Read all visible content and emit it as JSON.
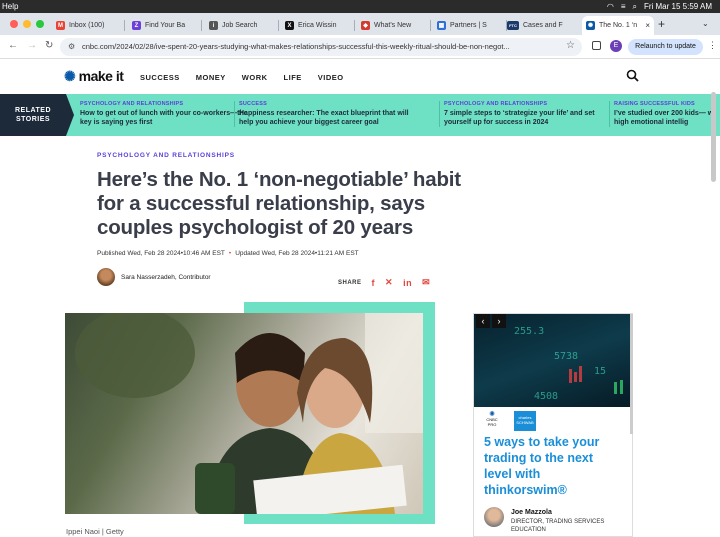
{
  "menubar": {
    "app_menu": "Help",
    "datetime": "Fri Mar 15  5:59 AM"
  },
  "tabs": [
    {
      "label": "Inbox (100)",
      "fav": "M",
      "color": "#ea4335"
    },
    {
      "label": "Find Your Ba",
      "fav": "Z",
      "color": "#6c3fd9"
    },
    {
      "label": "Job Search",
      "fav": "i",
      "color": "#555555"
    },
    {
      "label": "Erica Wissin",
      "fav": "X",
      "color": "#111111"
    },
    {
      "label": "What's New",
      "fav": "◆",
      "color": "#d23b2f"
    },
    {
      "label": "Partners | S",
      "fav": "▦",
      "color": "#2f6fd9"
    },
    {
      "label": "Cases and F",
      "fav": "FTC",
      "color": "#1b3a6b"
    },
    {
      "label": "The No. 1 ‘n",
      "fav": "✺",
      "color": "#0a5aa8"
    }
  ],
  "address": {
    "url": "cnbc.com/2024/02/28/ive-spent-20-years-studying-what-makes-relationships-successful-this-weekly-ritual-should-be-non-negot...",
    "relaunch": "Relaunch to update",
    "profile": "E"
  },
  "site": {
    "logo": "make it",
    "nav": [
      "SUCCESS",
      "MONEY",
      "WORK",
      "LIFE",
      "VIDEO"
    ]
  },
  "related": {
    "badge_line1": "RELATED",
    "badge_line2": "STORIES",
    "stories": [
      {
        "category": "PSYCHOLOGY AND RELATIONSHIPS",
        "headline": "How to get out of lunch with your co-workers—the key is saying yes first"
      },
      {
        "category": "SUCCESS",
        "headline": "Happiness researcher: The exact blueprint that will help you achieve your biggest career goal"
      },
      {
        "category": "PSYCHOLOGY AND RELATIONSHIPS",
        "headline": "7 simple steps to ‘strategize your life’ and set yourself up for success in 2024"
      },
      {
        "category": "RAISING SUCCESSFUL KIDS",
        "headline": "I’ve studied over 200 kids— with high emotional intellig"
      }
    ]
  },
  "article": {
    "kicker": "PSYCHOLOGY AND RELATIONSHIPS",
    "title": "Here’s the No. 1 ‘non-negotiable’ habit for a successful relationship, says couples psychologist of 20 years",
    "published": "Published Wed, Feb 28 2024•10:46 AM EST",
    "updated": "Updated Wed, Feb 28 2024•11:21 AM EST",
    "author": "Sara Nasserzadeh, Contributor",
    "share_label": "SHARE",
    "photo_credit": "Ippei Naoi | Getty"
  },
  "ad": {
    "brand1": "CNBC PRO",
    "brand2": "charles SCHWAB",
    "headline": "5 ways to take your trading to the next level with thinkorswim®",
    "person": "Joe Mazzola",
    "role": "DIRECTOR, TRADING SERVICES EDUCATION"
  }
}
